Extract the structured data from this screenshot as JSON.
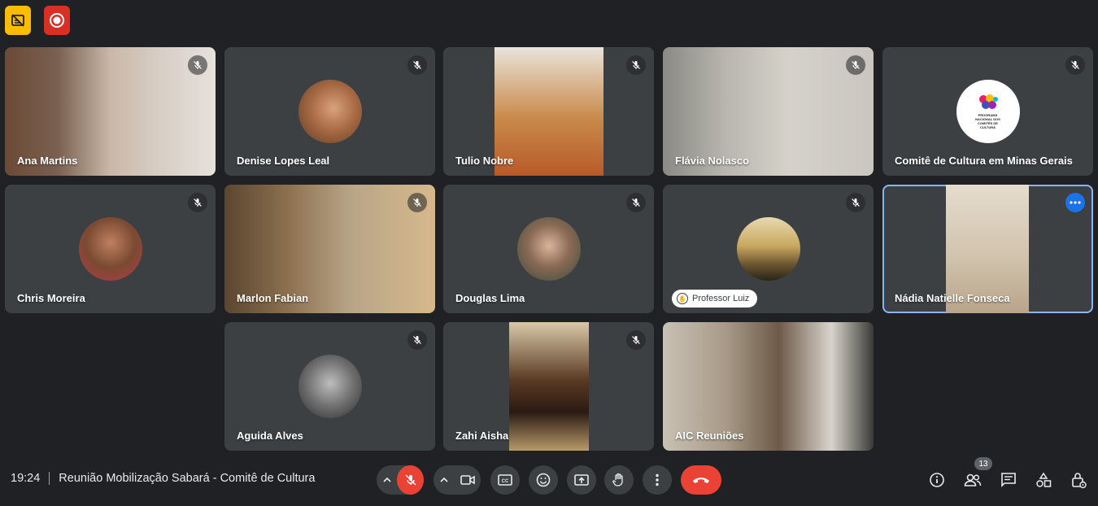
{
  "meeting": {
    "time": "19:24",
    "title": "Reunião Mobilização Sabará - Comitê de Cultura",
    "participant_count": "13"
  },
  "colors": {
    "background": "#202124",
    "tile": "#3c4043",
    "accent_red": "#ea4335",
    "active_outline": "#8ab4f8",
    "captions_badge": "#fbbc04"
  },
  "participants": [
    {
      "name": "Ana Martins",
      "muted": true,
      "view": "video"
    },
    {
      "name": "Denise Lopes Leal",
      "muted": true,
      "view": "avatar"
    },
    {
      "name": "Tulio Nobre",
      "muted": true,
      "view": "video"
    },
    {
      "name": "Flávia Nolasco",
      "muted": true,
      "view": "video"
    },
    {
      "name": "Comitê de Cultura em Minas Gerais",
      "muted": true,
      "view": "avatar",
      "logo_text": "PROGRAMA NACIONAL DOS COMITÊS DE CULTURA"
    },
    {
      "name": "Chris Moreira",
      "muted": true,
      "view": "avatar"
    },
    {
      "name": "Marlon Fabian",
      "muted": true,
      "view": "video"
    },
    {
      "name": "Douglas Lima",
      "muted": true,
      "view": "avatar"
    },
    {
      "name": "Professor Luiz",
      "muted": true,
      "view": "avatar",
      "hand_raised": true
    },
    {
      "name": "Nádia Natielle Fonseca",
      "muted": false,
      "view": "video",
      "active": true
    },
    {
      "name": "Aguida Alves",
      "muted": true,
      "view": "avatar"
    },
    {
      "name": "Zahi Aisha",
      "muted": true,
      "view": "video"
    },
    {
      "name": "AIC Reuniões",
      "muted": false,
      "view": "video"
    }
  ],
  "controls": {
    "mic": "mic-off-icon",
    "camera": "camera-icon",
    "captions": "captions-icon",
    "reactions": "emoji-icon",
    "present": "present-icon",
    "raise_hand": "hand-icon",
    "more": "more-vert-icon",
    "leave": "call-end-icon"
  },
  "right_controls": [
    "info-icon",
    "people-icon",
    "chat-icon",
    "activities-icon",
    "host-controls-icon"
  ]
}
